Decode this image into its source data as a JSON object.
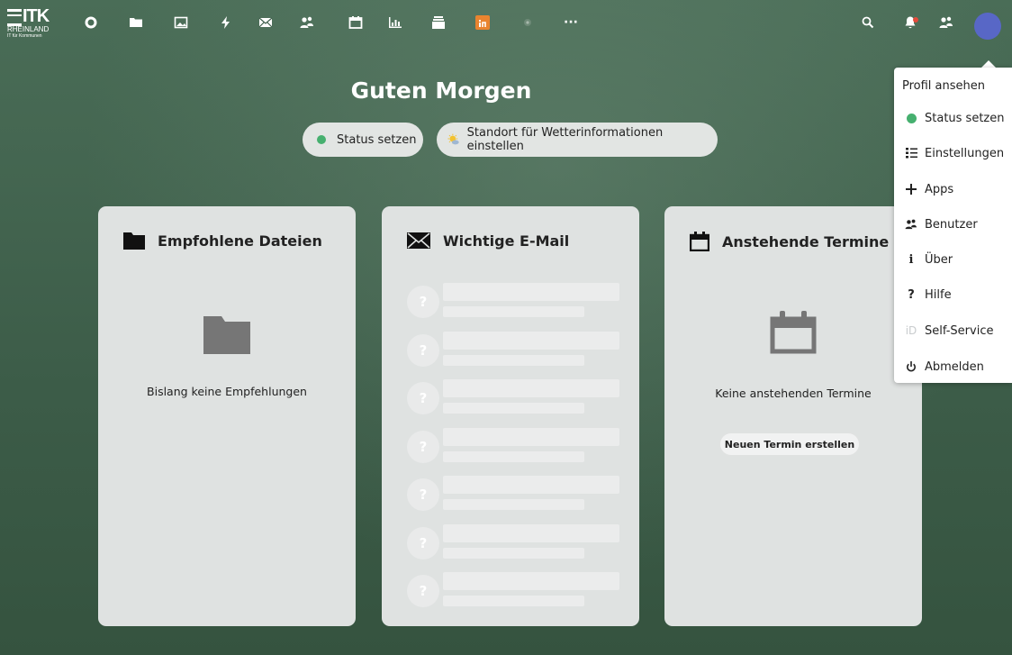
{
  "logo": {
    "big": "ITK",
    "mid": "RHEINLAND",
    "small": "IT für Kommunen"
  },
  "nav": {
    "apps": [
      "dashboard-icon",
      "files-icon",
      "photos-icon",
      "activity-icon",
      "mail-icon",
      "contacts-icon",
      "calendar-icon",
      "analytics-icon",
      "deck-icon",
      "onlyoffice-icon",
      "app-icon",
      "more-icon"
    ],
    "more_label": "···"
  },
  "header": {
    "greeting": "Guten Morgen"
  },
  "status_pill": {
    "label": "Status setzen",
    "dot_color": "#46b06f"
  },
  "weather_pill": {
    "label": "Standort für Wetterinformationen einstellen"
  },
  "cards": {
    "files": {
      "title": "Empfohlene Dateien",
      "empty": "Bislang keine Empfehlungen"
    },
    "mail": {
      "title": "Wichtige E-Mail",
      "placeholder_glyph": "?"
    },
    "calendar": {
      "title": "Anstehende Termine",
      "empty": "Keine anstehenden Termine",
      "button": "Neuen Termin erstellen"
    }
  },
  "menu": {
    "items": [
      {
        "label": "Profil ansehen",
        "icon": ""
      },
      {
        "label": "Status setzen",
        "icon": "status-dot-icon"
      },
      {
        "label": "Einstellungen",
        "icon": "settings-list-icon"
      },
      {
        "label": "Apps",
        "icon": "plus-icon"
      },
      {
        "label": "Benutzer",
        "icon": "users-icon"
      },
      {
        "label": "Über",
        "icon": "info-icon"
      },
      {
        "label": "Hilfe",
        "icon": "help-icon"
      },
      {
        "label": "Self-Service",
        "icon": "id-icon"
      },
      {
        "label": "Abmelden",
        "icon": "power-icon"
      }
    ]
  },
  "colors": {
    "accent": "#5867c6",
    "status_online": "#46b06f",
    "notification": "#e34a3b"
  }
}
